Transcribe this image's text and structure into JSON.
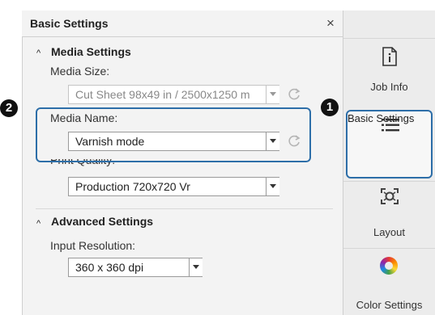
{
  "panel": {
    "title": "Basic Settings",
    "close_glyph": "×",
    "media_settings": {
      "heading": "Media Settings",
      "media_size_label": "Media Size:",
      "media_size_value": "Cut Sheet 98x49 in / 2500x1250 m",
      "media_name_label": "Media Name:",
      "media_name_value": "Varnish mode",
      "print_quality_label": "Print Quality:",
      "print_quality_value": "Production 720x720 Vr"
    },
    "advanced_settings": {
      "heading": "Advanced Settings",
      "input_resolution_label": "Input Resolution:",
      "input_resolution_value": "360 x 360 dpi"
    }
  },
  "callouts": {
    "one": "1",
    "two": "2"
  },
  "tabs": [
    {
      "label": "Job Info",
      "icon": "info-document-icon"
    },
    {
      "label": "Basic Settings",
      "icon": "list-icon",
      "selected": true
    },
    {
      "label": "Layout",
      "icon": "layout-icon"
    },
    {
      "label": "Color Settings",
      "icon": "color-ring-icon"
    }
  ],
  "colors": {
    "highlight": "#2d6ea8",
    "panel_bg": "#f3f3f3",
    "tab_bg": "#ececec"
  }
}
